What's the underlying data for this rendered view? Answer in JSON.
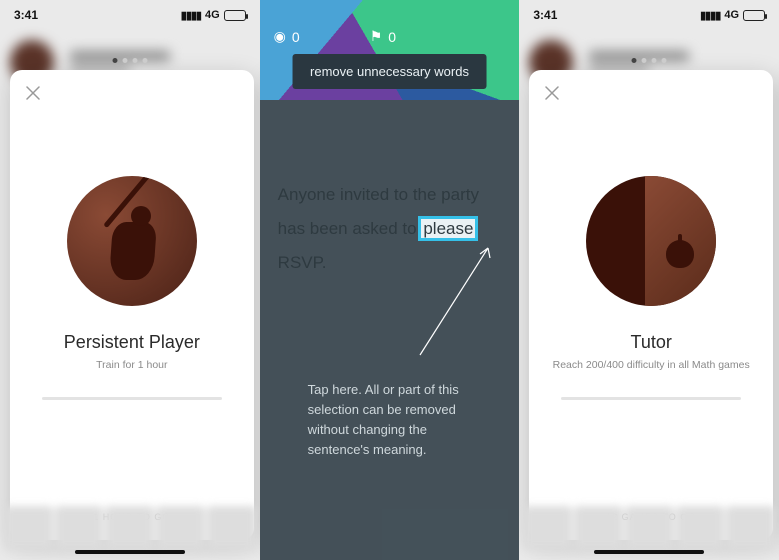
{
  "status": {
    "time": "3:41",
    "network": "4G"
  },
  "left_card": {
    "title": "Persistent Player",
    "subtitle": "Train for 1 hour",
    "footer": "1 HOUR TO GO",
    "badge_icon": "baseball-batter"
  },
  "right_card": {
    "title": "Tutor",
    "subtitle": "Reach 200/400 difficulty in all Math games",
    "footer": "12 GAMES TO GO",
    "badge_icon": "apple-door"
  },
  "middle": {
    "instruction": "remove unnecessary words",
    "stats": {
      "left_icon": "user-icon",
      "left_value": "0",
      "right_icon": "flag-icon",
      "right_value": "0"
    },
    "sentence_pre": "Anyone invited to the party has been asked to ",
    "sentence_highlight": "please",
    "sentence_post": " RSVP.",
    "hint": "Tap here. All or part of this selection can be removed without changing the sentence's meaning."
  }
}
